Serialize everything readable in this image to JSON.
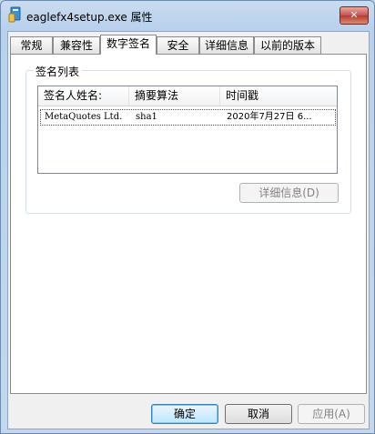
{
  "window": {
    "title": "eaglefx4setup.exe 属性",
    "close_label": "✕"
  },
  "tabs": [
    {
      "label": "常规"
    },
    {
      "label": "兼容性"
    },
    {
      "label": "数字签名",
      "active": true
    },
    {
      "label": "安全"
    },
    {
      "label": "详细信息"
    },
    {
      "label": "以前的版本"
    }
  ],
  "signature_list": {
    "group_label": "签名列表",
    "columns": [
      "签名人姓名:",
      "摘要算法",
      "时间戳"
    ],
    "rows": [
      {
        "signer": "MetaQuotes Ltd.",
        "algorithm": "sha1",
        "timestamp": "2020年7月27日 6..."
      }
    ],
    "details_button": "详细信息(D)"
  },
  "buttons": {
    "ok": "确定",
    "cancel": "取消",
    "apply": "应用(A)"
  },
  "icons": {
    "title": "file-properties-icon"
  }
}
